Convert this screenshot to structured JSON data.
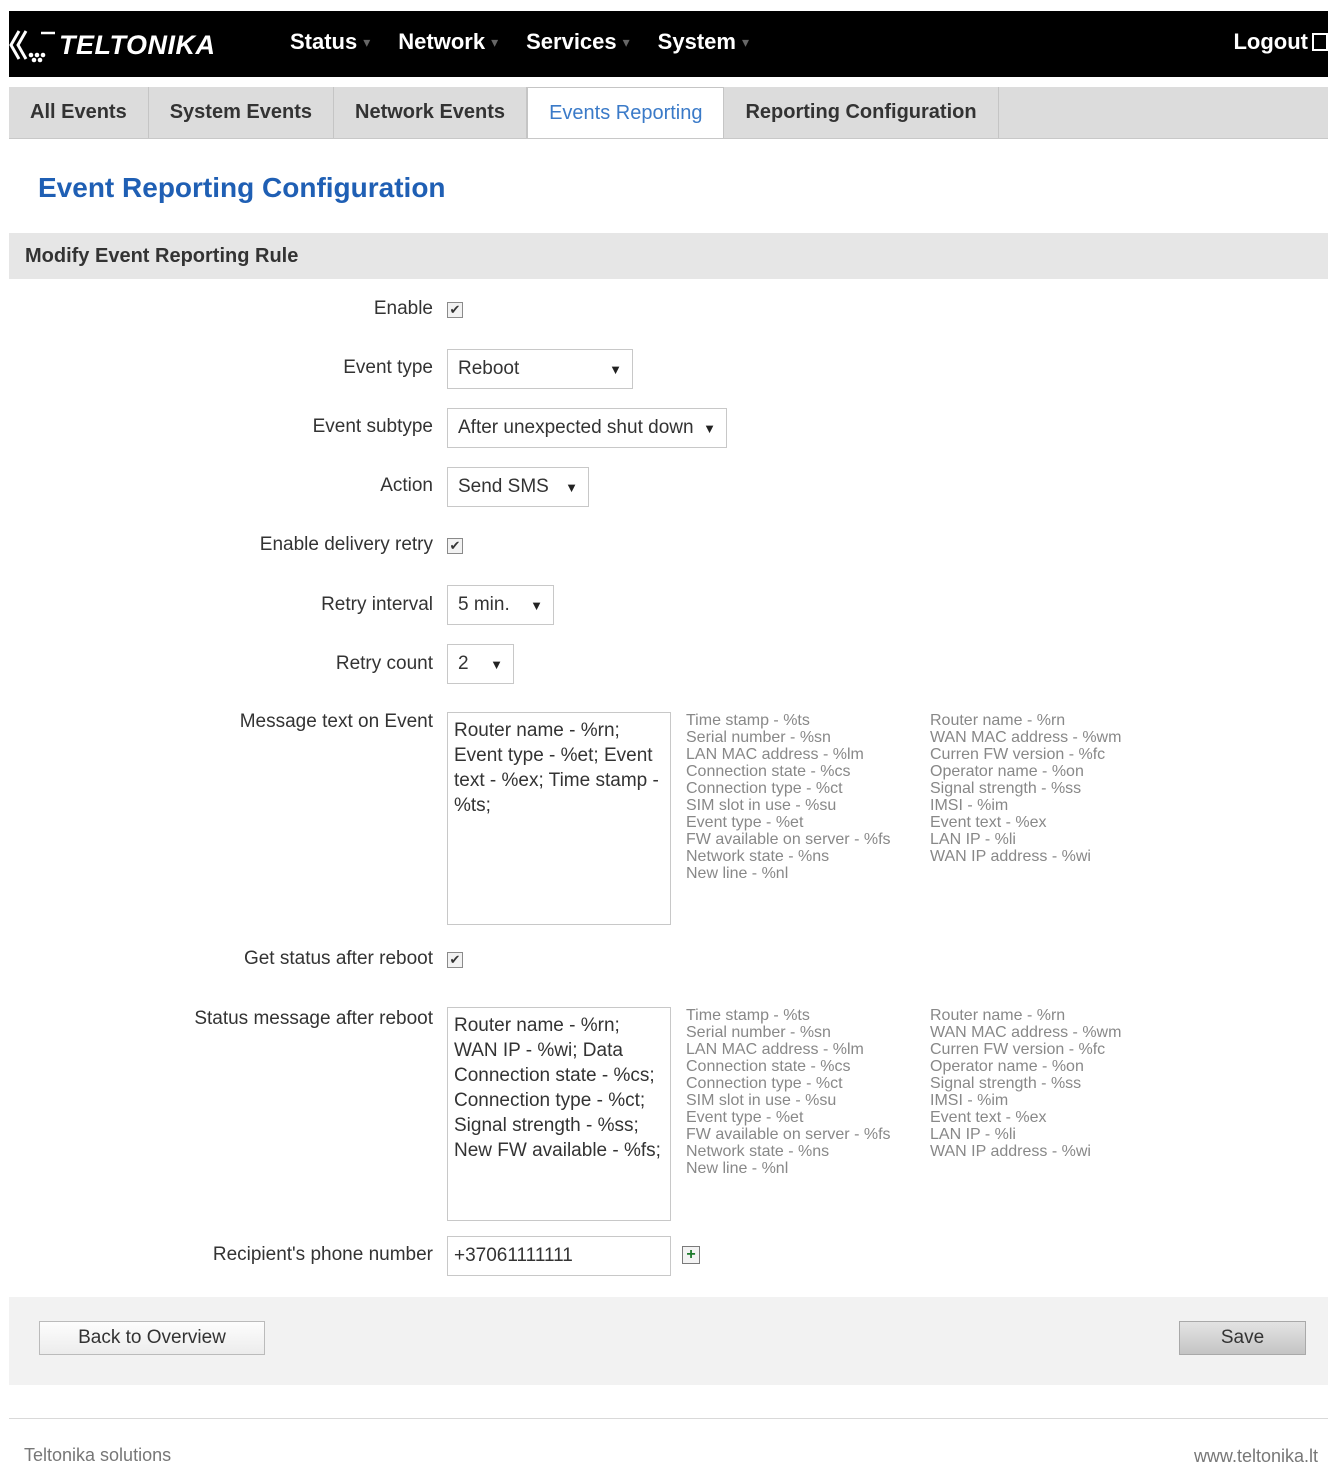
{
  "brand": {
    "logo_text": "TELTONIKA"
  },
  "topnav": {
    "items": [
      {
        "label": "Status"
      },
      {
        "label": "Network"
      },
      {
        "label": "Services"
      },
      {
        "label": "System"
      }
    ],
    "logout": "Logout"
  },
  "tabs": [
    {
      "label": "All Events",
      "active": false
    },
    {
      "label": "System Events",
      "active": false
    },
    {
      "label": "Network Events",
      "active": false
    },
    {
      "label": "Events Reporting",
      "active": true
    },
    {
      "label": "Reporting Configuration",
      "active": false
    }
  ],
  "page": {
    "title": "Event Reporting Configuration",
    "section_title": "Modify Event Reporting Rule"
  },
  "form": {
    "enable": {
      "label": "Enable",
      "checked": true
    },
    "event_type": {
      "label": "Event type",
      "value": "Reboot"
    },
    "event_subtype": {
      "label": "Event subtype",
      "value": "After unexpected shut down"
    },
    "action": {
      "label": "Action",
      "value": "Send SMS"
    },
    "delivery_retry": {
      "label": "Enable delivery retry",
      "checked": true
    },
    "retry_interval": {
      "label": "Retry interval",
      "value": "5 min."
    },
    "retry_count": {
      "label": "Retry count",
      "value": "2"
    },
    "message_text": {
      "label": "Message text on Event",
      "value": "Router name - %rn; Event type - %et; Event text - %ex; Time stamp - %ts;"
    },
    "status_after_reboot": {
      "label": "Get status after reboot",
      "checked": true
    },
    "status_message": {
      "label": "Status message after reboot",
      "value": "Router name - %rn; WAN IP - %wi; Data Connection state - %cs; Connection type - %ct; Signal strength - %ss; New FW available - %fs;"
    },
    "phone": {
      "label": "Recipient's phone number",
      "value": "+37061111111"
    }
  },
  "hints": {
    "col1": "Time stamp - %ts\nSerial number - %sn\nLAN MAC address - %lm\nConnection state - %cs\nConnection type - %ct\nSIM slot in use - %su\nEvent type - %et\nFW available on server - %fs\nNetwork state - %ns\nNew line - %nl",
    "col2": "Router name - %rn\nWAN MAC address - %wm\nCurren FW version - %fc\nOperator name - %on\nSignal strength - %ss\nIMSI - %im\nEvent text - %ex\nLAN IP - %li\nWAN IP address - %wi"
  },
  "buttons": {
    "back": "Back to Overview",
    "save": "Save"
  },
  "footer": {
    "left": "Teltonika solutions",
    "right": "www.teltonika.lt"
  },
  "icons": {
    "checkbox": "check-icon",
    "dropdown": "chevron-down-icon",
    "add": "plus-icon",
    "logout": "logout-icon"
  }
}
